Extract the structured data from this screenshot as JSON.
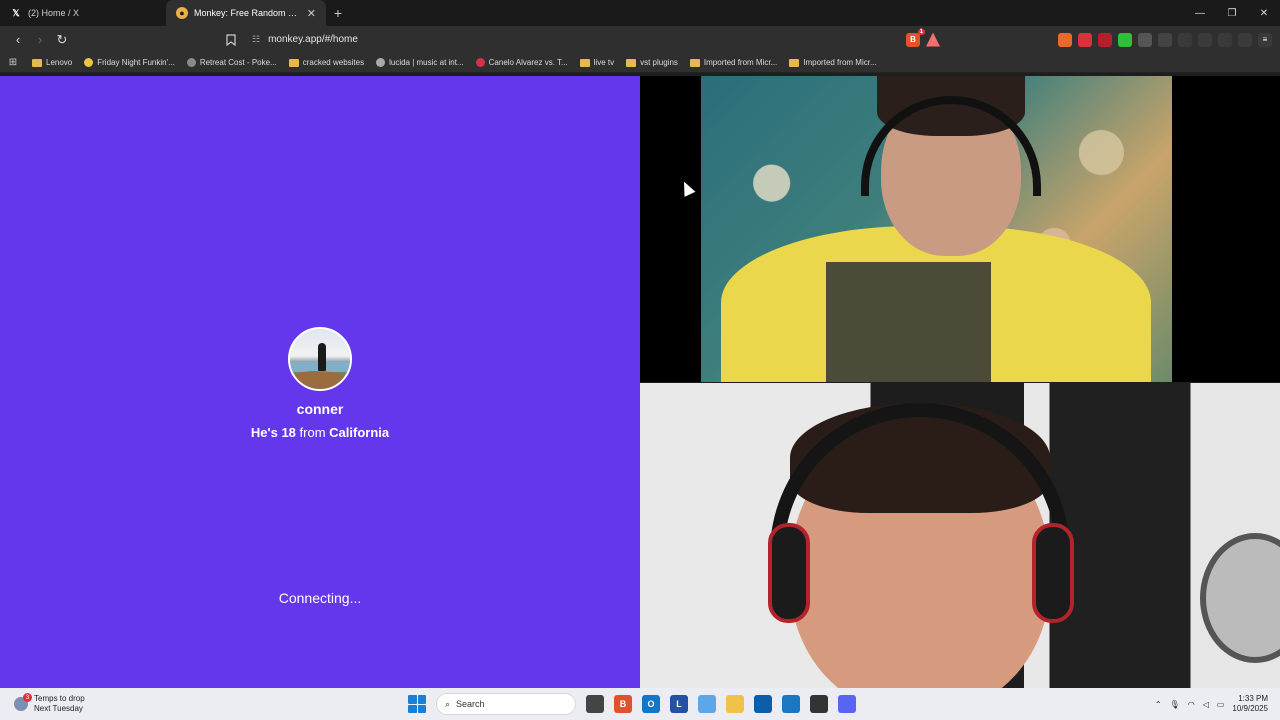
{
  "browser": {
    "tabs": [
      {
        "title": "(2) Home / X",
        "favicon": "x-icon",
        "active": false
      },
      {
        "title": "Monkey: Free Random Video...",
        "favicon": "monkey-icon",
        "active": true
      }
    ],
    "new_tab": "+",
    "url": "monkey.app/#/home",
    "shield_badge": "1",
    "bookmarks": [
      {
        "label": "Lenovo",
        "icon": "folder-icon"
      },
      {
        "label": "Friday Night Funkin'...",
        "icon": "banana-icon"
      },
      {
        "label": "Retreat Cost - Poke...",
        "icon": "globe-icon"
      },
      {
        "label": "cracked websites",
        "icon": "folder-icon"
      },
      {
        "label": "lucida | music at int...",
        "icon": "disc-icon"
      },
      {
        "label": "Canelo Alvarez vs. T...",
        "icon": "s-icon"
      },
      {
        "label": "live tv",
        "icon": "folder-icon"
      },
      {
        "label": "vst plugins",
        "icon": "folder-icon"
      },
      {
        "label": "Imported from Micr...",
        "icon": "folder-icon"
      },
      {
        "label": "Imported from Micr...",
        "icon": "folder-icon"
      }
    ]
  },
  "match": {
    "username": "conner",
    "info_prefix": "He's",
    "age": "18",
    "info_mid": "from",
    "location": "California",
    "status": "Connecting..."
  },
  "taskbar": {
    "weather_line1": "Temps to drop",
    "weather_line2": "Next Tuesday",
    "weather_badge": "3",
    "search_placeholder": "Search",
    "time": "1:33 PM",
    "date": "10/9/2025"
  },
  "colors": {
    "panel_purple": "#6437ec",
    "taskbar": "#ecedf2"
  }
}
